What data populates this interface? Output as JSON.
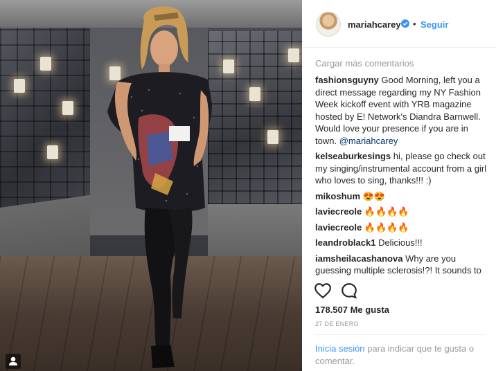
{
  "post": {
    "username": "mariahcarey",
    "follow_label": "Seguir",
    "dot": "•",
    "load_more": "Cargar más comentarios",
    "comments": [
      {
        "user": "fashionsguyny",
        "text": "Good Morning, left you a direct message regarding my NY Fashion Week kickoff event with YRB magazine hosted by E! Network's Diandra Barnwell. Would love your presence if you are in town.",
        "mention": "@mariahcarey"
      },
      {
        "user": "kelseaburkesings",
        "text": "hi, please go check out my singing/instrumental account from a girl who loves to sing, thanks!!! :)"
      },
      {
        "user": "mikoshum",
        "text": "😍😍"
      },
      {
        "user": "laviecreole",
        "text": "🔥🔥🔥🔥"
      },
      {
        "user": "laviecreole",
        "text": "🔥🔥🔥🔥"
      },
      {
        "user": "leandroblack1",
        "text": "Delicious!!!"
      },
      {
        "user": "iamsheilacashanova",
        "text": "Why are you guessing multiple sclerosis!?! It sounds to severe to repeat!!"
      }
    ],
    "likes": "178.507 Me gusta",
    "date": "27 DE ENERO",
    "login_link": "Inicia sesión",
    "login_rest": " para indicar que te gusta o comentar."
  },
  "icons": [
    "heart-icon",
    "comment-icon",
    "verified-badge-icon",
    "user-tag-icon"
  ],
  "colors": {
    "accent": "#3897f0",
    "verified": "#3897f0",
    "muted": "#999999",
    "text": "#262626"
  }
}
